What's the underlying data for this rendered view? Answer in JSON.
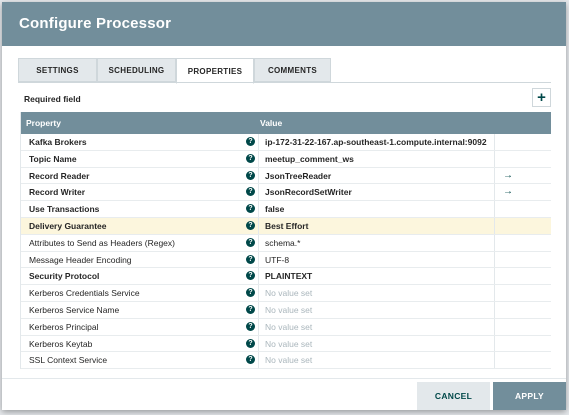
{
  "dialog": {
    "title": "Configure Processor"
  },
  "tabs": [
    {
      "label": "SETTINGS",
      "active": false
    },
    {
      "label": "SCHEDULING",
      "active": false
    },
    {
      "label": "PROPERTIES",
      "active": true
    },
    {
      "label": "COMMENTS",
      "active": false
    }
  ],
  "required_label": "Required field",
  "add_icon": "plus-icon",
  "table": {
    "header_property": "Property",
    "header_value": "Value",
    "rows": [
      {
        "name": "Kafka Brokers",
        "value": "ip-172-31-22-167.ap-southeast-1.compute.internal:9092",
        "required": true,
        "empty": false,
        "goto": false,
        "highlight": false
      },
      {
        "name": "Topic Name",
        "value": "meetup_comment_ws",
        "required": true,
        "empty": false,
        "goto": false,
        "highlight": false
      },
      {
        "name": "Record Reader",
        "value": "JsonTreeReader",
        "required": true,
        "empty": false,
        "goto": true,
        "highlight": false
      },
      {
        "name": "Record Writer",
        "value": "JsonRecordSetWriter",
        "required": true,
        "empty": false,
        "goto": true,
        "highlight": false
      },
      {
        "name": "Use Transactions",
        "value": "false",
        "required": true,
        "empty": false,
        "goto": false,
        "highlight": false
      },
      {
        "name": "Delivery Guarantee",
        "value": "Best Effort",
        "required": true,
        "empty": false,
        "goto": false,
        "highlight": true
      },
      {
        "name": "Attributes to Send as Headers (Regex)",
        "value": "schema.*",
        "required": false,
        "empty": false,
        "goto": false,
        "highlight": false
      },
      {
        "name": "Message Header Encoding",
        "value": "UTF-8",
        "required": false,
        "empty": false,
        "goto": false,
        "highlight": false
      },
      {
        "name": "Security Protocol",
        "value": "PLAINTEXT",
        "required": true,
        "empty": false,
        "goto": false,
        "highlight": false
      },
      {
        "name": "Kerberos Credentials Service",
        "value": "No value set",
        "required": false,
        "empty": true,
        "goto": false,
        "highlight": false
      },
      {
        "name": "Kerberos Service Name",
        "value": "No value set",
        "required": false,
        "empty": true,
        "goto": false,
        "highlight": false
      },
      {
        "name": "Kerberos Principal",
        "value": "No value set",
        "required": false,
        "empty": true,
        "goto": false,
        "highlight": false
      },
      {
        "name": "Kerberos Keytab",
        "value": "No value set",
        "required": false,
        "empty": true,
        "goto": false,
        "highlight": false
      },
      {
        "name": "SSL Context Service",
        "value": "No value set",
        "required": false,
        "empty": true,
        "goto": false,
        "highlight": false
      }
    ]
  },
  "footer": {
    "cancel_label": "CANCEL",
    "apply_label": "APPLY"
  },
  "colors": {
    "header": "#728e9b",
    "accent": "#004849",
    "highlight_row": "#fcf6dd"
  }
}
